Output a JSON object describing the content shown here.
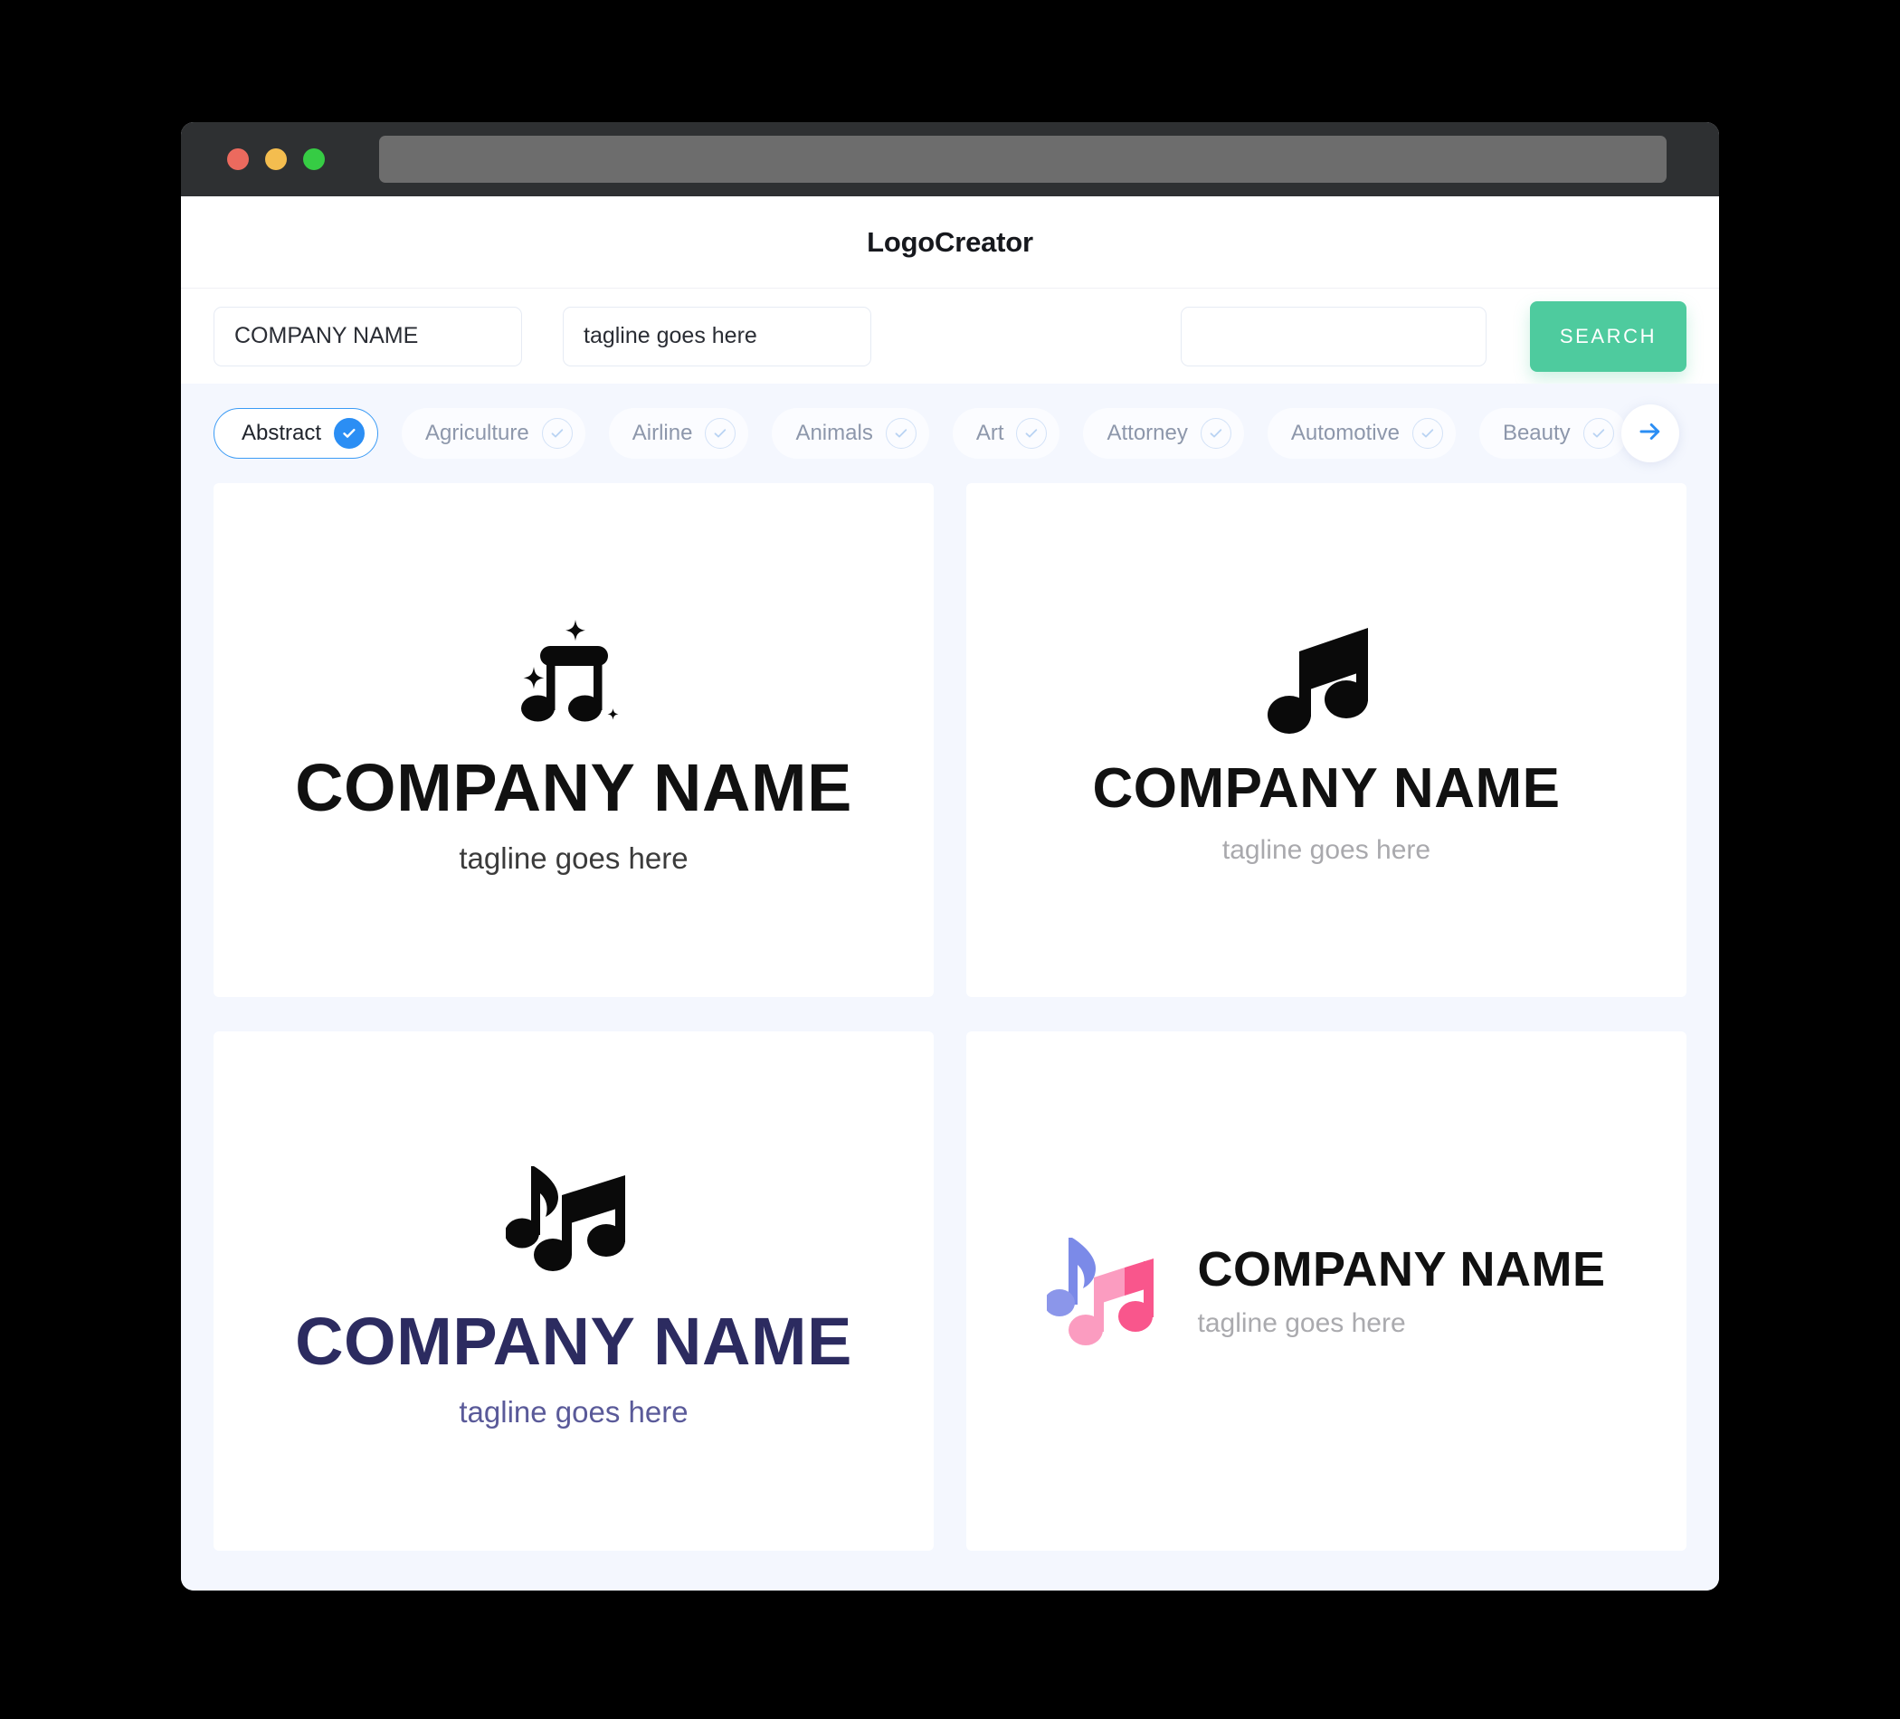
{
  "window": {
    "traffic_lights": [
      "close",
      "minimize",
      "maximize"
    ],
    "url_value": ""
  },
  "header": {
    "app_title": "LogoCreator"
  },
  "search": {
    "company_value": "COMPANY NAME",
    "company_placeholder": "COMPANY NAME",
    "tagline_value": "tagline goes here",
    "tagline_placeholder": "tagline goes here",
    "keyword_value": "",
    "keyword_placeholder": "",
    "search_label": "SEARCH",
    "search_color": "#4ecb9e"
  },
  "categories": {
    "next_arrow_icon": "arrow-right-icon",
    "accent_color": "#2b8ef4",
    "items": [
      {
        "label": "Abstract",
        "selected": true
      },
      {
        "label": "Agriculture",
        "selected": false
      },
      {
        "label": "Airline",
        "selected": false
      },
      {
        "label": "Animals",
        "selected": false
      },
      {
        "label": "Art",
        "selected": false
      },
      {
        "label": "Attorney",
        "selected": false
      },
      {
        "label": "Automotive",
        "selected": false
      },
      {
        "label": "Beauty",
        "selected": false
      }
    ]
  },
  "results": {
    "cards": [
      {
        "layout": "stacked",
        "mark": "beamed-notes-with-sparkles-icon",
        "name": "COMPANY NAME",
        "tagline": "tagline goes here",
        "name_color": "#111111",
        "tagline_color": "#3b3b3b"
      },
      {
        "layout": "stacked",
        "mark": "angled-beamed-note-icon",
        "name": "COMPANY NAME",
        "tagline": "tagline goes here",
        "name_color": "#111111",
        "tagline_color": "#a9a9ad"
      },
      {
        "layout": "stacked",
        "mark": "eighth-note-and-beamed-pair-icon",
        "name": "COMPANY NAME",
        "tagline": "tagline goes here",
        "name_color": "#2c2b60",
        "tagline_color": "#5a5a99"
      },
      {
        "layout": "horizontal",
        "mark": "colored-notes-icon",
        "name": "COMPANY NAME",
        "tagline": "tagline goes here",
        "name_color": "#111111",
        "tagline_color": "#aaaaae",
        "mark_colors": {
          "blue": "#7b8ae8",
          "pink_light": "#fb9cc0",
          "pink": "#f9568c"
        }
      }
    ]
  }
}
